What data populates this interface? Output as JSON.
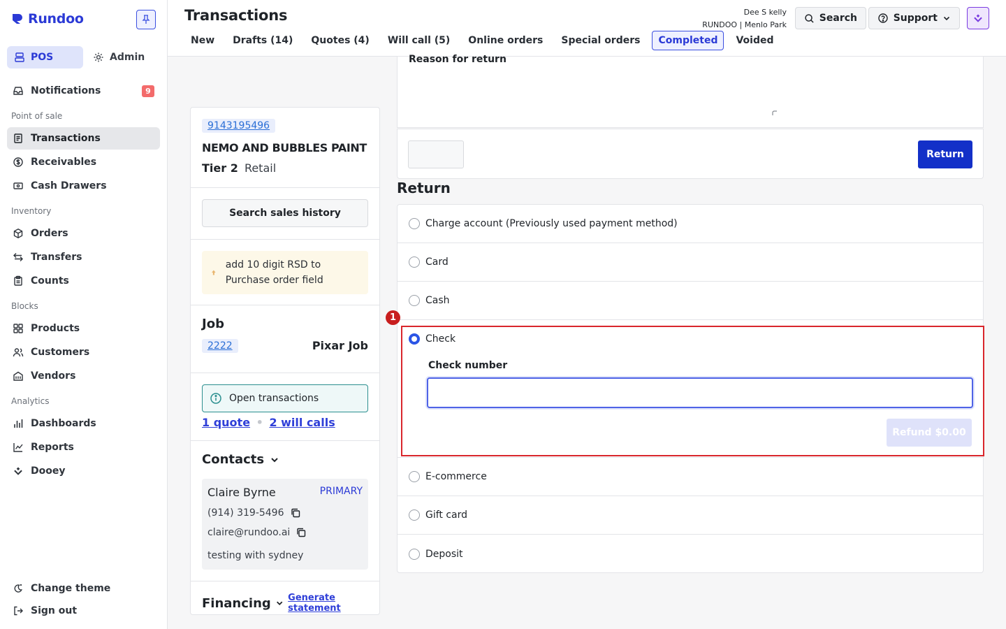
{
  "brand": {
    "name": "Rundoo",
    "color": "#2b3ad6"
  },
  "sidebar": {
    "modes": [
      {
        "label": "POS"
      },
      {
        "label": "Admin"
      }
    ],
    "notifications": {
      "label": "Notifications",
      "count": "9"
    },
    "sections": [
      {
        "title": "Point of sale",
        "items": [
          "Transactions",
          "Receivables",
          "Cash Drawers"
        ]
      },
      {
        "title": "Inventory",
        "items": [
          "Orders",
          "Transfers",
          "Counts"
        ]
      },
      {
        "title": "Blocks",
        "items": [
          "Products",
          "Customers",
          "Vendors"
        ]
      },
      {
        "title": "Analytics",
        "items": [
          "Dashboards",
          "Reports",
          "Dooey"
        ]
      }
    ],
    "footer": [
      "Change theme",
      "Sign out"
    ]
  },
  "header": {
    "title": "Transactions",
    "tabs": [
      "New",
      "Drafts (14)",
      "Quotes (4)",
      "Will call (5)",
      "Online orders",
      "Special orders",
      "Completed",
      "Voided"
    ],
    "active_tab": "Completed",
    "user": {
      "name": "Dee S kelly",
      "store": "RUNDOO | Menlo Park"
    },
    "search_label": "Search",
    "support_label": "Support"
  },
  "customer": {
    "account_id": "9143195496",
    "name": "NEMO AND BUBBLES PAINT",
    "tier": "Tier 2",
    "type": "Retail",
    "search_history_label": "Search sales history",
    "note": "add 10 digit RSD to Purchase order field",
    "job": {
      "heading": "Job",
      "id": "2222",
      "name": "Pixar Job"
    },
    "open_transactions": {
      "label": "Open transactions",
      "quote_link": "1 quote",
      "separator": "•",
      "will_call_link": "2 will calls"
    },
    "contacts": {
      "heading": "Contacts",
      "primary": {
        "name": "Claire Byrne",
        "tag": "PRIMARY",
        "phone": "(914) 319-5496",
        "email": "claire@rundoo.ai",
        "note": "testing with sydney"
      }
    },
    "financing": {
      "heading": "Financing",
      "statement_link": "Generate statement"
    }
  },
  "return_form": {
    "reason_label": "Reason for return",
    "return_button": "Return",
    "section_title": "Return",
    "options": [
      "Charge account (Previously used payment method)",
      "Card",
      "Cash",
      "Check",
      "E-commerce",
      "Gift card",
      "Deposit"
    ],
    "selected_option": "Check",
    "check_number_label": "Check number",
    "check_number_value": "",
    "refund_button": "Refund $0.00",
    "annotation_marker": "1"
  },
  "colors": {
    "accent": "#2b55e6",
    "primary_button": "#1330c8",
    "highlight_border": "#d9262c",
    "notification_badge": "#f36b6b"
  }
}
